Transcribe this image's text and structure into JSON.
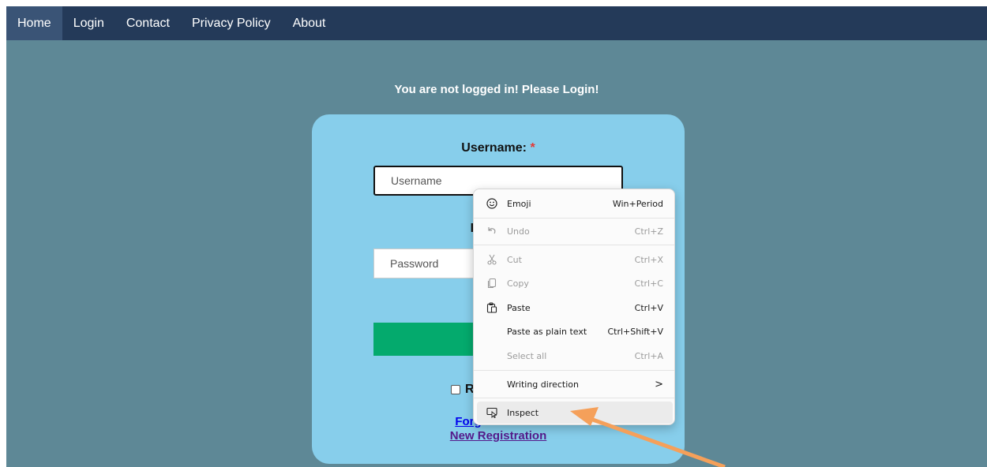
{
  "nav": {
    "items": [
      {
        "label": "Home",
        "active": true
      },
      {
        "label": "Login"
      },
      {
        "label": "Contact"
      },
      {
        "label": "Privacy Policy"
      },
      {
        "label": "About"
      }
    ]
  },
  "notice": "You are not logged in! Please Login!",
  "form": {
    "username_label": "Username:",
    "required_mark": "*",
    "username_placeholder": "Username",
    "password_label_partial": "P",
    "password_placeholder": "Password",
    "remember_partial": "R",
    "forgot_partial": "Forg",
    "new_registration": "New Registration"
  },
  "context_menu": {
    "items": [
      {
        "icon": "emoji-icon",
        "label": "Emoji",
        "shortcut": "Win+Period",
        "disabled": false
      },
      {
        "icon": "undo-icon",
        "label": "Undo",
        "shortcut": "Ctrl+Z",
        "disabled": true
      },
      {
        "icon": "cut-icon",
        "label": "Cut",
        "shortcut": "Ctrl+X",
        "disabled": true
      },
      {
        "icon": "copy-icon",
        "label": "Copy",
        "shortcut": "Ctrl+C",
        "disabled": true
      },
      {
        "icon": "paste-icon",
        "label": "Paste",
        "shortcut": "Ctrl+V",
        "disabled": false
      },
      {
        "icon": "",
        "label": "Paste as plain text",
        "shortcut": "Ctrl+Shift+V",
        "disabled": false
      },
      {
        "icon": "",
        "label": "Select all",
        "shortcut": "Ctrl+A",
        "disabled": true
      },
      {
        "icon": "",
        "label": "Writing direction",
        "shortcut": ">",
        "disabled": false
      },
      {
        "icon": "inspect-icon",
        "label": "Inspect",
        "shortcut": "",
        "disabled": false
      }
    ]
  },
  "colors": {
    "nav_bg": "#243a59",
    "page_bg": "#5e8896",
    "card_bg": "#87ceeb",
    "button_green": "#04aa6d",
    "arrow": "#f5a05a"
  }
}
